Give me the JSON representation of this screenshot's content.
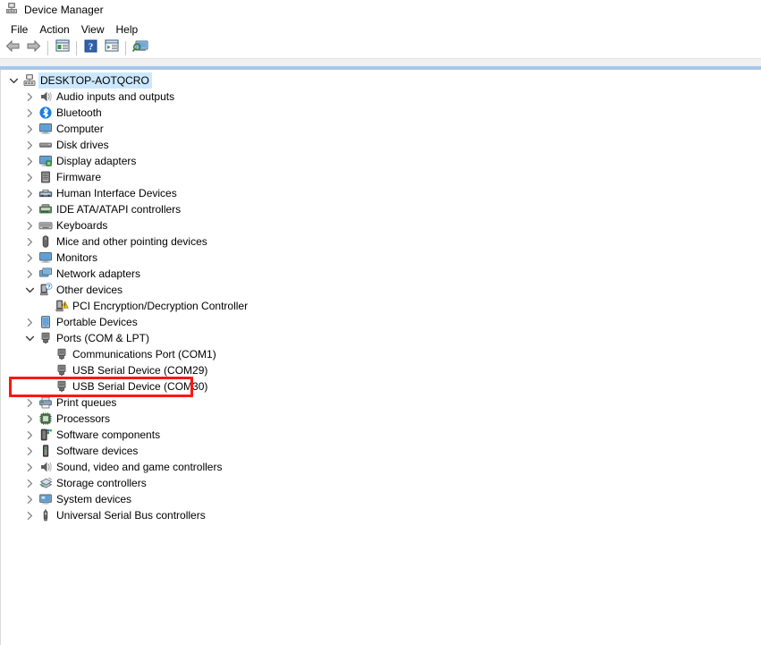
{
  "window": {
    "title": "Device Manager",
    "icon": "device-manager-icon"
  },
  "menubar": {
    "items": [
      {
        "label": "File",
        "name": "menu-file"
      },
      {
        "label": "Action",
        "name": "menu-action"
      },
      {
        "label": "View",
        "name": "menu-view"
      },
      {
        "label": "Help",
        "name": "menu-help"
      }
    ]
  },
  "toolbar": {
    "buttons": [
      {
        "name": "back-button",
        "icon": "back-arrow-icon",
        "tooltip": "Back"
      },
      {
        "name": "forward-button",
        "icon": "forward-arrow-icon",
        "tooltip": "Forward"
      },
      {
        "name": "properties-button",
        "icon": "properties-icon",
        "tooltip": "Properties"
      },
      {
        "name": "help-button",
        "icon": "help-question-icon",
        "tooltip": "Help"
      },
      {
        "name": "update-driver-button",
        "icon": "update-driver-icon",
        "tooltip": "Update driver"
      },
      {
        "name": "scan-hardware-button",
        "icon": "scan-for-hardware-changes-icon",
        "tooltip": "Scan for hardware changes"
      }
    ]
  },
  "tree": {
    "root": {
      "label": "DESKTOP-AOTQCRO",
      "icon": "computer-root-icon",
      "expanded": true,
      "selected": true
    },
    "nodes": [
      {
        "label": "Audio inputs and outputs",
        "icon": "speaker-icon",
        "level": 1,
        "state": "collapsed"
      },
      {
        "label": "Bluetooth",
        "icon": "bluetooth-icon",
        "level": 1,
        "state": "collapsed"
      },
      {
        "label": "Computer",
        "icon": "monitor-icon",
        "level": 1,
        "state": "collapsed"
      },
      {
        "label": "Disk drives",
        "icon": "disk-drive-icon",
        "level": 1,
        "state": "collapsed"
      },
      {
        "label": "Display adapters",
        "icon": "display-adapter-icon",
        "level": 1,
        "state": "collapsed"
      },
      {
        "label": "Firmware",
        "icon": "firmware-chip-icon",
        "level": 1,
        "state": "collapsed"
      },
      {
        "label": "Human Interface Devices",
        "icon": "hid-icon",
        "level": 1,
        "state": "collapsed"
      },
      {
        "label": "IDE ATA/ATAPI controllers",
        "icon": "ide-controller-icon",
        "level": 1,
        "state": "collapsed"
      },
      {
        "label": "Keyboards",
        "icon": "keyboard-icon",
        "level": 1,
        "state": "collapsed"
      },
      {
        "label": "Mice and other pointing devices",
        "icon": "mouse-icon",
        "level": 1,
        "state": "collapsed"
      },
      {
        "label": "Monitors",
        "icon": "monitor-icon",
        "level": 1,
        "state": "collapsed"
      },
      {
        "label": "Network adapters",
        "icon": "network-adapter-icon",
        "level": 1,
        "state": "collapsed"
      },
      {
        "label": "Other devices",
        "icon": "other-devices-question-icon",
        "level": 1,
        "state": "expanded"
      },
      {
        "label": "PCI Encryption/Decryption Controller",
        "icon": "warning-device-icon",
        "level": 2,
        "state": "leaf"
      },
      {
        "label": "Portable Devices",
        "icon": "portable-device-icon",
        "level": 1,
        "state": "collapsed"
      },
      {
        "label": "Ports (COM & LPT)",
        "icon": "port-icon",
        "level": 1,
        "state": "expanded"
      },
      {
        "label": "Communications Port (COM1)",
        "icon": "port-icon",
        "level": 2,
        "state": "leaf"
      },
      {
        "label": "USB Serial Device (COM29)",
        "icon": "port-icon",
        "level": 2,
        "state": "leaf"
      },
      {
        "label": "USB Serial Device (COM30)",
        "icon": "port-icon",
        "level": 2,
        "state": "leaf",
        "highlighted": true
      },
      {
        "label": "Print queues",
        "icon": "printer-icon",
        "level": 1,
        "state": "collapsed"
      },
      {
        "label": "Processors",
        "icon": "processor-icon",
        "level": 1,
        "state": "collapsed"
      },
      {
        "label": "Software components",
        "icon": "software-component-icon",
        "level": 1,
        "state": "collapsed"
      },
      {
        "label": "Software devices",
        "icon": "software-device-icon",
        "level": 1,
        "state": "collapsed"
      },
      {
        "label": "Sound, video and game controllers",
        "icon": "speaker-icon",
        "level": 1,
        "state": "collapsed"
      },
      {
        "label": "Storage controllers",
        "icon": "storage-controller-icon",
        "level": 1,
        "state": "collapsed"
      },
      {
        "label": "System devices",
        "icon": "system-device-icon",
        "level": 1,
        "state": "collapsed"
      },
      {
        "label": "Universal Serial Bus controllers",
        "icon": "usb-icon",
        "level": 1,
        "state": "collapsed"
      }
    ]
  },
  "annotation": {
    "name": "red-highlight-box",
    "target_label": "USB Serial Device (COM30)",
    "color": "#fb1712"
  },
  "colors": {
    "selection": "#cce8ff",
    "annotation": "#fb1712",
    "band": "#a8c7e8"
  }
}
